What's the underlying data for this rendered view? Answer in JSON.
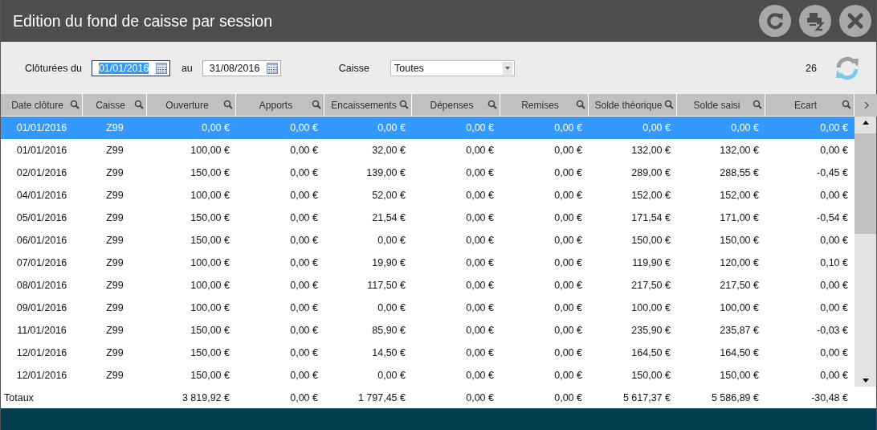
{
  "window": {
    "title": "Edition du fond de caisse par session"
  },
  "filters": {
    "from_label": "Clôturées du",
    "from": {
      "value": "01/01/2016",
      "focused": true
    },
    "to_label": "au",
    "to": {
      "value": "31/08/2016",
      "focused": false
    },
    "register_label": "Caisse",
    "register": "Toutes",
    "count": "26"
  },
  "table": {
    "columns": [
      "Date clôture",
      "Caisse",
      "Ouverture",
      "Apports",
      "Encaissements",
      "Dépenses",
      "Remises",
      "Solde théorique",
      "Solde saisi",
      "Ecart"
    ],
    "rows": [
      {
        "selected": true,
        "cells": [
          "01/01/2016",
          "Z99",
          "0,00 €",
          "0,00 €",
          "0,00 €",
          "0,00 €",
          "0,00 €",
          "0,00 €",
          "0,00 €",
          "0,00 €"
        ]
      },
      {
        "selected": false,
        "cells": [
          "01/01/2016",
          "Z99",
          "100,00 €",
          "0,00 €",
          "32,00 €",
          "0,00 €",
          "0,00 €",
          "132,00 €",
          "132,00 €",
          "0,00 €"
        ]
      },
      {
        "selected": false,
        "cells": [
          "02/01/2016",
          "Z99",
          "150,00 €",
          "0,00 €",
          "139,00 €",
          "0,00 €",
          "0,00 €",
          "289,00 €",
          "288,55 €",
          "-0,45 €"
        ]
      },
      {
        "selected": false,
        "cells": [
          "04/01/2016",
          "Z99",
          "100,00 €",
          "0,00 €",
          "52,00 €",
          "0,00 €",
          "0,00 €",
          "152,00 €",
          "152,00 €",
          "0,00 €"
        ]
      },
      {
        "selected": false,
        "cells": [
          "05/01/2016",
          "Z99",
          "150,00 €",
          "0,00 €",
          "21,54 €",
          "0,00 €",
          "0,00 €",
          "171,54 €",
          "171,00 €",
          "-0,54 €"
        ]
      },
      {
        "selected": false,
        "cells": [
          "06/01/2016",
          "Z99",
          "150,00 €",
          "0,00 €",
          "0,00 €",
          "0,00 €",
          "0,00 €",
          "150,00 €",
          "150,00 €",
          "0,00 €"
        ]
      },
      {
        "selected": false,
        "cells": [
          "07/01/2016",
          "Z99",
          "100,00 €",
          "0,00 €",
          "19,90 €",
          "0,00 €",
          "0,00 €",
          "119,90 €",
          "120,00 €",
          "0,10 €"
        ]
      },
      {
        "selected": false,
        "cells": [
          "08/01/2016",
          "Z99",
          "100,00 €",
          "0,00 €",
          "117,50 €",
          "0,00 €",
          "0,00 €",
          "217,50 €",
          "217,50 €",
          "0,00 €"
        ]
      },
      {
        "selected": false,
        "cells": [
          "09/01/2016",
          "Z99",
          "100,00 €",
          "0,00 €",
          "0,00 €",
          "0,00 €",
          "0,00 €",
          "100,00 €",
          "100,00 €",
          "0,00 €"
        ]
      },
      {
        "selected": false,
        "cells": [
          "11/01/2016",
          "Z99",
          "150,00 €",
          "0,00 €",
          "85,90 €",
          "0,00 €",
          "0,00 €",
          "235,90 €",
          "235,87 €",
          "-0,03 €"
        ]
      },
      {
        "selected": false,
        "cells": [
          "12/01/2016",
          "Z99",
          "150,00 €",
          "0,00 €",
          "14,50 €",
          "0,00 €",
          "0,00 €",
          "164,50 €",
          "164,50 €",
          "0,00 €"
        ]
      },
      {
        "selected": false,
        "cells": [
          "12/01/2016",
          "Z99",
          "150,00 €",
          "0,00 €",
          "0,00 €",
          "0,00 €",
          "0,00 €",
          "150,00 €",
          "150,00 €",
          "0,00 €"
        ]
      }
    ],
    "totals": {
      "label": "Totaux",
      "values": [
        "3 819,92 €",
        "0,00 €",
        "1 797,45 €",
        "0,00 €",
        "0,00 €",
        "5 617,37 €",
        "5 586,89 €",
        "-30,48 €"
      ]
    }
  }
}
